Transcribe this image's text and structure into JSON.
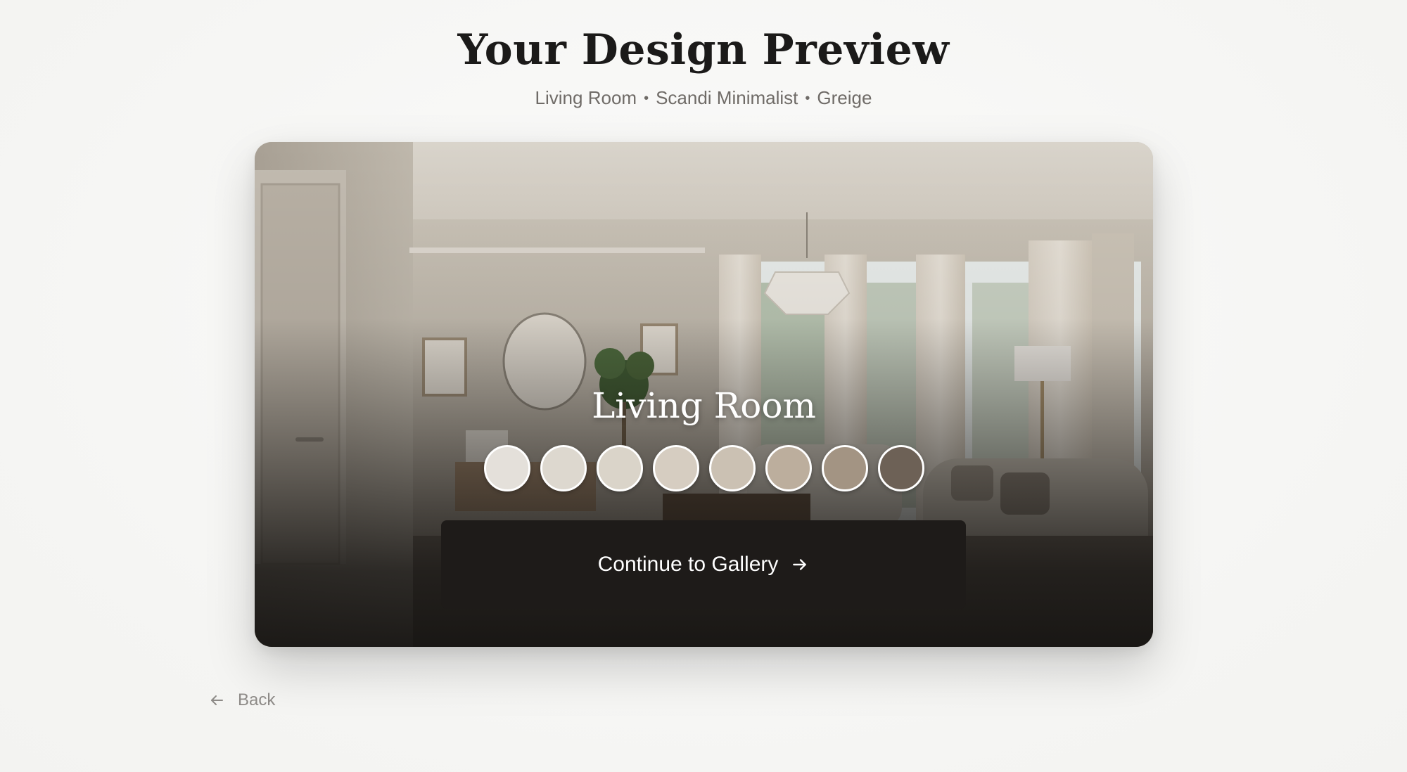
{
  "header": {
    "title": "Your Design Preview",
    "subtitle_parts": [
      "Living Room",
      "Scandi Minimalist",
      "Greige"
    ],
    "separator": "•"
  },
  "preview": {
    "room_name": "Living Room",
    "palette": [
      "#e4e0da",
      "#ddd8cf",
      "#dad4c9",
      "#d6cdc1",
      "#cbc1b3",
      "#bcae9d",
      "#a39483",
      "#6d6156"
    ],
    "cta_label": "Continue to Gallery",
    "cta_icon": "arrow-right-icon"
  },
  "footer": {
    "back_label": "Back",
    "back_icon": "arrow-left-icon"
  }
}
